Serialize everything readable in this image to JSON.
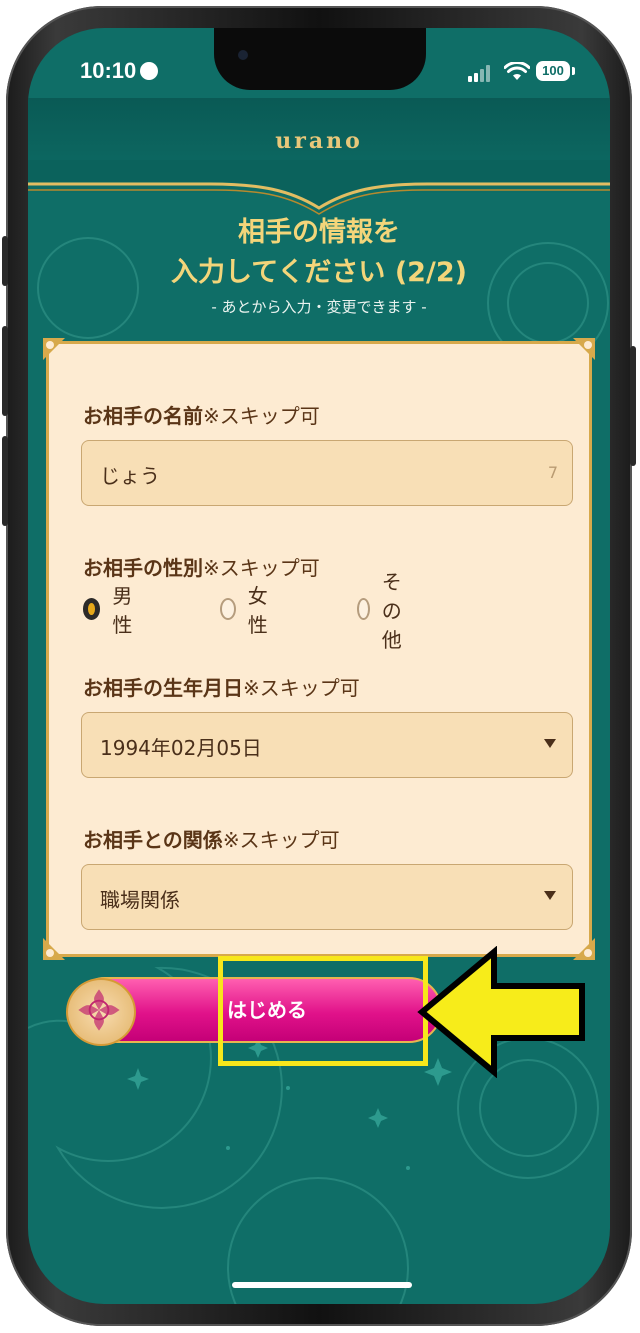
{
  "status": {
    "time": "10:10",
    "battery": "100"
  },
  "app": {
    "logo": "urano"
  },
  "page": {
    "title_line1": "相手の情報を",
    "title_line2": "入力してください (2/2)",
    "subtitle": "- あとから入力・変更できます -"
  },
  "form": {
    "name": {
      "label": "お相手の名前",
      "skip": "※スキップ可",
      "value": "じょう",
      "count": "7"
    },
    "gender": {
      "label": "お相手の性別",
      "skip": "※スキップ可",
      "options": [
        "男性",
        "女性",
        "その他"
      ],
      "selected": "男性"
    },
    "birthdate": {
      "label": "お相手の生年月日",
      "skip": "※スキップ可",
      "value": "1994年02月05日"
    },
    "relation": {
      "label": "お相手との関係",
      "skip": "※スキップ可",
      "value": "職場関係"
    }
  },
  "start_button": {
    "label": "はじめる"
  },
  "colors": {
    "background": "#0f6e67",
    "card": "#fdebd2",
    "gold": "#d7a94b",
    "button": "#e1128a",
    "highlight": "#f7e71b"
  }
}
